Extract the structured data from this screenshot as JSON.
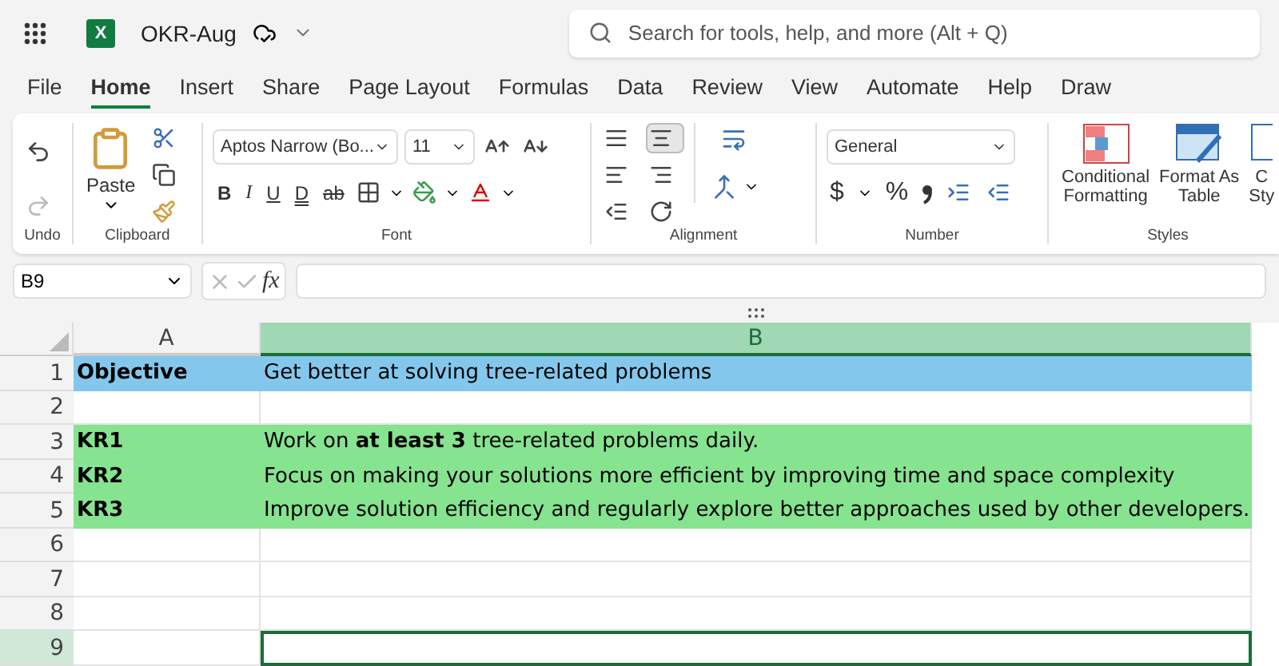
{
  "title_bar": {
    "app_letter": "X",
    "file_name": "OKR-Aug",
    "search_placeholder": "Search for tools, help, and more (Alt + Q)"
  },
  "tabs": [
    {
      "label": "File",
      "selected": false
    },
    {
      "label": "Home",
      "selected": true
    },
    {
      "label": "Insert",
      "selected": false
    },
    {
      "label": "Share",
      "selected": false
    },
    {
      "label": "Page Layout",
      "selected": false
    },
    {
      "label": "Formulas",
      "selected": false
    },
    {
      "label": "Data",
      "selected": false
    },
    {
      "label": "Review",
      "selected": false
    },
    {
      "label": "View",
      "selected": false
    },
    {
      "label": "Automate",
      "selected": false
    },
    {
      "label": "Help",
      "selected": false
    },
    {
      "label": "Draw",
      "selected": false
    }
  ],
  "ribbon": {
    "undo": {
      "label": "Undo",
      "redo_disabled": true
    },
    "clipboard": {
      "label": "Clipboard",
      "paste": "Paste"
    },
    "font": {
      "label": "Font",
      "font_name": "Aptos Narrow (Bo...",
      "font_size": "11",
      "styles": [
        {
          "kind": "bold",
          "text": "B"
        },
        {
          "kind": "italic",
          "text": "I"
        },
        {
          "kind": "underline",
          "text": "U"
        },
        {
          "kind": "double_underline",
          "text": "D"
        },
        {
          "kind": "strikethrough",
          "text": "ab"
        }
      ]
    },
    "alignment": {
      "label": "Alignment",
      "buttons": [
        {
          "kind": "top",
          "selected": false
        },
        {
          "kind": "middle",
          "selected": true
        },
        {
          "kind": "left",
          "selected": false
        },
        {
          "kind": "right",
          "selected": false
        },
        {
          "kind": "decrease_indent",
          "selected": false
        },
        {
          "kind": "orientation",
          "selected": false
        }
      ]
    },
    "number": {
      "label": "Number",
      "format": "General",
      "currency": "$",
      "percent": "%"
    },
    "styles": {
      "label": "Styles",
      "items": [
        {
          "kind": "conditional",
          "lines": [
            "Conditional",
            "Formatting"
          ]
        },
        {
          "kind": "table",
          "lines": [
            "Format As",
            "Table"
          ]
        },
        {
          "kind": "cell",
          "lines": [
            "C",
            "Sty"
          ]
        }
      ]
    }
  },
  "formula_bar": {
    "name_box": "B9",
    "fx": "fx"
  },
  "grid": {
    "columns": [
      {
        "label": "A",
        "selected": false
      },
      {
        "label": "B",
        "selected": true
      }
    ],
    "rows": [
      {
        "number": "1",
        "color": "#83c8ec",
        "selected": false,
        "cells": [
          "Objective",
          "Get better at solving tree-related problems"
        ]
      },
      {
        "number": "2",
        "selected": false,
        "cells": [
          "",
          ""
        ]
      },
      {
        "number": "3",
        "color": "#86e38f",
        "selected": false,
        "cells": [
          "KR1",
          "Work on **at least 3** tree-related problems daily."
        ]
      },
      {
        "number": "4",
        "color": "#86e38f",
        "selected": false,
        "cells": [
          "KR2",
          "Focus on making your solutions more efficient by improving time and space complexity"
        ]
      },
      {
        "number": "5",
        "color": "#86e38f",
        "selected": false,
        "cells": [
          "KR3",
          "Improve solution efficiency and regularly explore better approaches used by other developers."
        ]
      },
      {
        "number": "6",
        "selected": false,
        "cells": [
          "",
          ""
        ]
      },
      {
        "number": "7",
        "selected": false,
        "cells": [
          "",
          ""
        ]
      },
      {
        "number": "8",
        "selected": false,
        "cells": [
          "",
          ""
        ]
      },
      {
        "number": "9",
        "selected": true,
        "cells": [
          "",
          ""
        ]
      }
    ]
  }
}
